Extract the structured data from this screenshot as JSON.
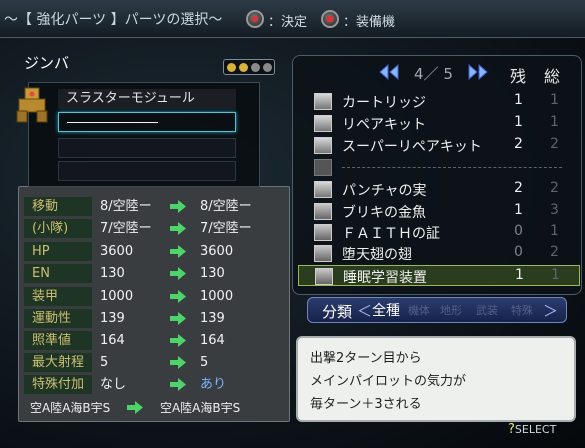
{
  "header": {
    "title": "～【 強化パーツ 】パーツの選択～",
    "confirm_label": "：決定",
    "equip_label": "：装備機"
  },
  "unit": {
    "name": "ジンバ",
    "slot_colors": [
      "#d7b339",
      "#d7b339",
      "#8a8a8a",
      "#8a8a8a"
    ]
  },
  "slots": {
    "slot1": "スラスターモジュール",
    "slot2": "―――――――",
    "slot3": "",
    "slot4": ""
  },
  "stats": [
    {
      "label": "移動",
      "before": "8/空陸ー",
      "after": "8/空陸ー",
      "after_highlight": false
    },
    {
      "label": "(小隊)",
      "before": "7/空陸ー",
      "after": "7/空陸ー",
      "after_highlight": false
    },
    {
      "label": "HP",
      "before": "3600",
      "after": "3600",
      "after_highlight": false
    },
    {
      "label": "EN",
      "before": "130",
      "after": "130",
      "after_highlight": false
    },
    {
      "label": "装甲",
      "before": "1000",
      "after": "1000",
      "after_highlight": false
    },
    {
      "label": "運動性",
      "before": "139",
      "after": "139",
      "after_highlight": false
    },
    {
      "label": "照準値",
      "before": "164",
      "after": "164",
      "after_highlight": false
    },
    {
      "label": "最大射程",
      "before": "5",
      "after": "5",
      "after_highlight": false
    },
    {
      "label": "特殊付加",
      "before": "なし",
      "after": "あり",
      "after_highlight": true
    }
  ],
  "terrain": {
    "before": "空A陸A海B宇S",
    "after": "空A陸A海B宇S"
  },
  "list": {
    "page_current": "4",
    "page_total": "5",
    "col_remaining": "残",
    "col_total": "総",
    "items": [
      {
        "name": "カートリッジ",
        "remaining": "1",
        "total": "1",
        "icon": "module-icon"
      },
      {
        "name": "リペアキット",
        "remaining": "1",
        "total": "1",
        "icon": "module-icon"
      },
      {
        "name": "スーパーリペアキット",
        "remaining": "2",
        "total": "2",
        "icon": "module-icon"
      },
      {
        "name": "",
        "remaining": "",
        "total": "",
        "icon": "empty-icon"
      },
      {
        "name": "パンチャの実",
        "remaining": "2",
        "total": "2",
        "icon": "module-icon"
      },
      {
        "name": "ブリキの金魚",
        "remaining": "1",
        "total": "3",
        "icon": "star-icon"
      },
      {
        "name": "ＦＡＩＴＨの証",
        "remaining": "0",
        "total": "1",
        "icon": "star-icon"
      },
      {
        "name": "堕天翅の翅",
        "remaining": "0",
        "total": "2",
        "icon": "star-icon"
      },
      {
        "name": "睡眠学習装置",
        "remaining": "1",
        "total": "1",
        "icon": "star-icon"
      }
    ]
  },
  "classification": {
    "label": "分類",
    "options": [
      "全種",
      "機体",
      "地形",
      "武装",
      "特殊"
    ],
    "active": "全種"
  },
  "description": {
    "lines": [
      "出撃2ターン目から",
      "メインパイロットの気力が",
      "毎ターン＋3される"
    ]
  },
  "footer": {
    "select_hint": "SELECT"
  }
}
